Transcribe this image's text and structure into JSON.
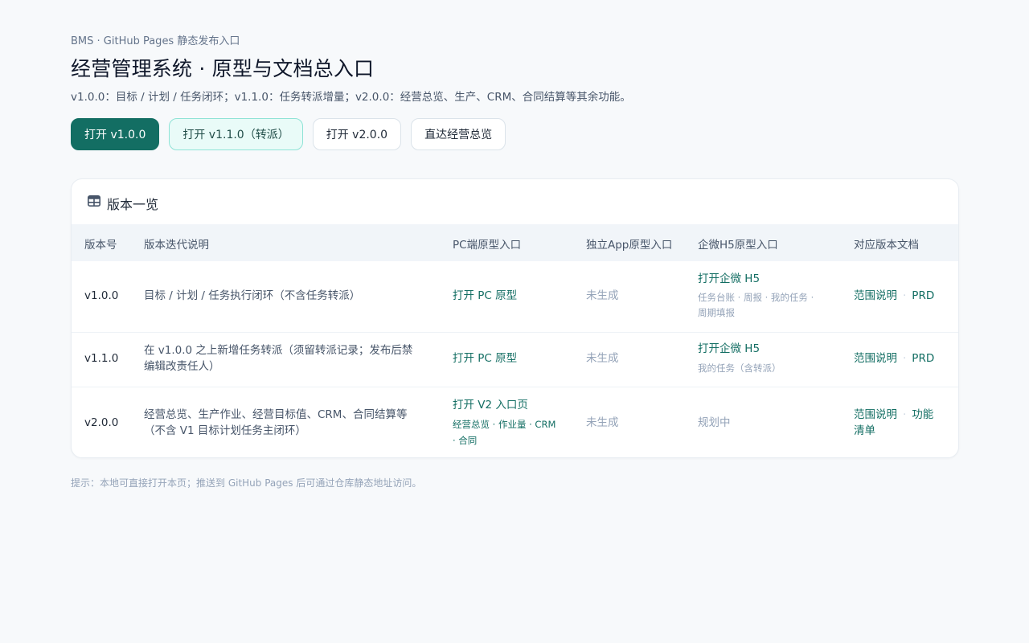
{
  "breadcrumb": "BMS · GitHub Pages 静态发布入口",
  "title": "经营管理系统 · 原型与文档总入口",
  "subtitle": "v1.0.0：目标 / 计划 / 任务闭环；v1.1.0：任务转派增量；v2.0.0：经营总览、生产、CRM、合同结算等其余功能。",
  "buttons": {
    "b1": "打开 v1.0.0",
    "b2": "打开 v1.1.0（转派）",
    "b3": "打开 v2.0.0",
    "b4": "直达经营总览"
  },
  "card": {
    "title": "版本一览",
    "icon": "table-icon"
  },
  "table": {
    "headers": {
      "version": "版本号",
      "desc": "版本迭代说明",
      "pc": "PC端原型入口",
      "app": "独立App原型入口",
      "h5": "企微H5原型入口",
      "docs": "对应版本文档"
    },
    "rows": [
      {
        "version": "v1.0.0",
        "desc": "目标 / 计划 / 任务执行闭环（不含任务转派）",
        "pc": "打开 PC 原型",
        "app": "未生成",
        "h5_link": "打开企微 H5",
        "h5_note_1": "任务台账 · 周报 · 我的任务 ·",
        "h5_note_2": "周期填报",
        "doc_1": "范围说明",
        "doc_2": "PRD"
      },
      {
        "version": "v1.1.0",
        "desc_1": "在 v1.0.0 之上新增任务转派（须留转派记录；发布后禁",
        "desc_2": "编辑改责任人）",
        "pc": "打开 PC 原型",
        "app": "未生成",
        "h5_link": "打开企微 H5",
        "h5_note_1": "我的任务（含转派）",
        "doc_1": "范围说明",
        "doc_2": "PRD"
      },
      {
        "version": "v2.0.0",
        "desc_1": "经营总览、生产作业、经营目标值、CRM、合同结算等",
        "desc_2": "（不含 V1 目标计划任务主闭环）",
        "pc": "打开 V2 入口页",
        "pc_sub_1": "经营总览 · 作业量 · CRM",
        "pc_sub_2": "· 合同",
        "app": "未生成",
        "h5": "规划中",
        "doc_1": "范围说明",
        "doc_2a": "功能",
        "doc_2b": "清单"
      }
    ]
  },
  "footer": "提示：本地可直接打开本页；推送到 GitHub Pages 后可通过仓库静态地址访问。",
  "colors": {
    "accent": "#136e63",
    "background": "#f7f9fb",
    "muted": "#94a3b8"
  }
}
